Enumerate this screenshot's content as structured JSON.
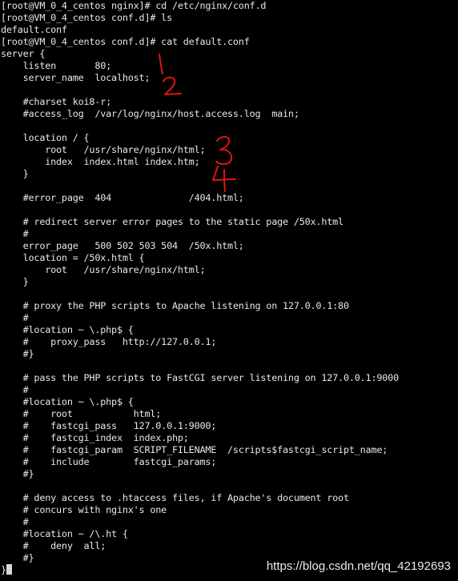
{
  "terminal": {
    "lines": [
      "[root@VM_0_4_centos nginx]# cd /etc/nginx/conf.d",
      "[root@VM_0_4_centos conf.d]# ls",
      "default.conf",
      "[root@VM_0_4_centos conf.d]# cat default.conf",
      "server {",
      "    listen       80;",
      "    server_name  localhost;",
      "",
      "    #charset koi8-r;",
      "    #access_log  /var/log/nginx/host.access.log  main;",
      "",
      "    location / {",
      "        root   /usr/share/nginx/html;",
      "        index  index.html index.htm;",
      "    }",
      "",
      "    #error_page  404              /404.html;",
      "",
      "    # redirect server error pages to the static page /50x.html",
      "    #",
      "    error_page   500 502 503 504  /50x.html;",
      "    location = /50x.html {",
      "        root   /usr/share/nginx/html;",
      "    }",
      "",
      "    # proxy the PHP scripts to Apache listening on 127.0.0.1:80",
      "    #",
      "    #location ~ \\.php$ {",
      "    #    proxy_pass   http://127.0.0.1;",
      "    #}",
      "",
      "    # pass the PHP scripts to FastCGI server listening on 127.0.0.1:9000",
      "    #",
      "    #location ~ \\.php$ {",
      "    #    root           html;",
      "    #    fastcgi_pass   127.0.0.1:9000;",
      "    #    fastcgi_index  index.php;",
      "    #    fastcgi_param  SCRIPT_FILENAME  /scripts$fastcgi_script_name;",
      "    #    include        fastcgi_params;",
      "    #}",
      "",
      "    # deny access to .htaccess files, if Apache's document root",
      "    # concurs with nginx's one",
      "    #",
      "    #location ~ /\\.ht {",
      "    #    deny  all;",
      "    #}",
      "}"
    ]
  },
  "annotations": {
    "color": "#e0140e",
    "marks": [
      "1",
      "2",
      "3",
      "4"
    ]
  },
  "watermark": {
    "text": "https://blog.csdn.net/qq_42192693"
  },
  "colors": {
    "background": "#000000",
    "foreground": "#e8e8e8"
  }
}
